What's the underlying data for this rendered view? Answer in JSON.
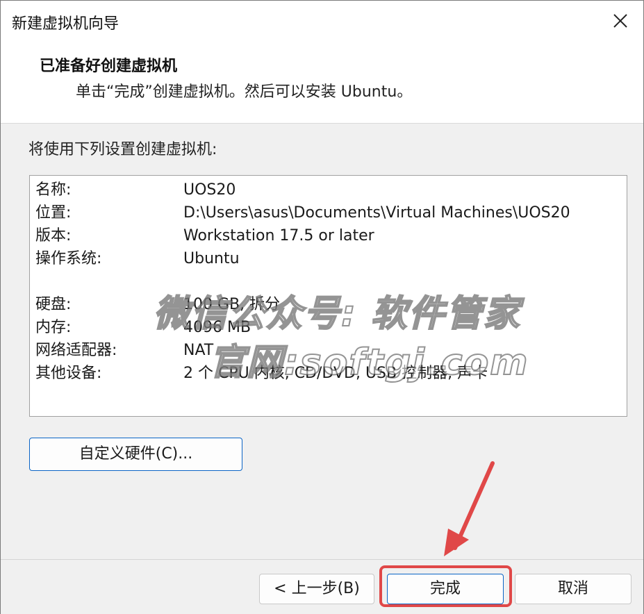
{
  "window": {
    "title": "新建虚拟机向导"
  },
  "header": {
    "title": "已准备好创建虚拟机",
    "subtitle": "单击“完成”创建虚拟机。然后可以安装 Ubuntu。"
  },
  "main": {
    "label": "将使用下列设置创建虚拟机:",
    "settings": [
      {
        "key": "名称:",
        "value": "UOS20"
      },
      {
        "key": "位置:",
        "value": "D:\\Users\\asus\\Documents\\Virtual Machines\\UOS20"
      },
      {
        "key": "版本:",
        "value": "Workstation 17.5 or later"
      },
      {
        "key": "操作系统:",
        "value": "Ubuntu"
      },
      {
        "key": "硬盘:",
        "value": "100 GB, 拆分"
      },
      {
        "key": "内存:",
        "value": "4096 MB"
      },
      {
        "key": "网络适配器:",
        "value": "NAT"
      },
      {
        "key": "其他设备:",
        "value": "2 个 CPU 内核, CD/DVD, USB 控制器, 声卡"
      }
    ],
    "customize_label": "自定义硬件(C)..."
  },
  "footer": {
    "back_label": "< 上一步(B)",
    "finish_label": "完成",
    "cancel_label": "取消"
  },
  "watermark": {
    "line1": "微信公众号: 软件管家",
    "line2": "官网:softgj.com"
  },
  "colors": {
    "accent": "#0a64c6",
    "annotation": "#e04848"
  },
  "icons": {
    "close": "close-icon",
    "annotation_arrow": "arrow-icon"
  }
}
